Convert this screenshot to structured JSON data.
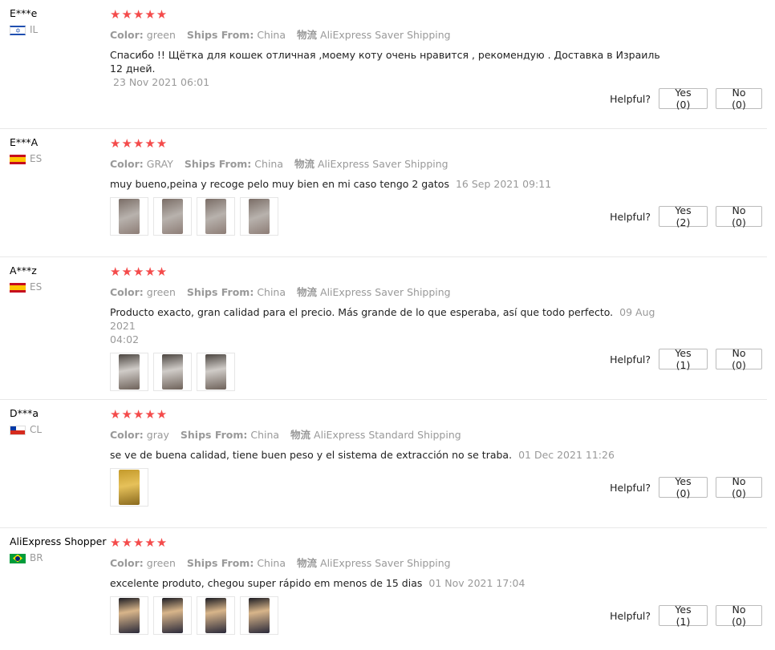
{
  "labels": {
    "color": "Color:",
    "ships_from": "Ships From:",
    "logistics": "物流",
    "helpful": "Helpful?",
    "stars": "★★★★★"
  },
  "colors": {
    "star": "#f44b4b",
    "muted": "#999999"
  },
  "reviews": [
    {
      "user": "E***e",
      "country": "IL",
      "rating": 5,
      "color": "green",
      "ships_from": "China",
      "shipping": "AliExpress Saver Shipping",
      "text": "Спасибо !! Щётка для кошек отличная ,моему коту очень нравится , рекомендую . Доставка в Израиль 12 дней.",
      "date": "23 Nov 2021 06:01",
      "yes": "Yes (0)",
      "no": "No (0)"
    },
    {
      "user": "E***A",
      "country": "ES",
      "rating": 5,
      "color": "GRAY",
      "ships_from": "China",
      "shipping": "AliExpress Saver Shipping",
      "text": "muy bueno,peina y recoge pelo muy bien en mi caso tengo 2 gatos",
      "date": "16 Sep 2021 09:11",
      "yes": "Yes (2)",
      "no": "No (0)"
    },
    {
      "user": "A***z",
      "country": "ES",
      "rating": 5,
      "color": "green",
      "ships_from": "China",
      "shipping": "AliExpress Saver Shipping",
      "text": "Producto exacto, gran calidad para el precio. Más grande de lo que esperaba, así que todo perfecto.",
      "date_a": "09 Aug 2021",
      "date_b": "04:02",
      "yes": "Yes (1)",
      "no": "No (0)"
    },
    {
      "user": "D***a",
      "country": "CL",
      "rating": 5,
      "color": "gray",
      "ships_from": "China",
      "shipping": "AliExpress Standard Shipping",
      "text": "se ve de buena calidad, tiene buen peso y el sistema de extracción no se traba.",
      "date": "01 Dec 2021 11:26",
      "yes": "Yes (0)",
      "no": "No (0)"
    },
    {
      "user": "AliExpress Shopper",
      "country": "BR",
      "rating": 5,
      "color": "green",
      "ships_from": "China",
      "shipping": "AliExpress Saver Shipping",
      "text": "excelente produto, chegou super rápido em menos de 15 dias",
      "date": "01 Nov 2021 17:04",
      "yes": "Yes (1)",
      "no": "No (0)"
    }
  ]
}
